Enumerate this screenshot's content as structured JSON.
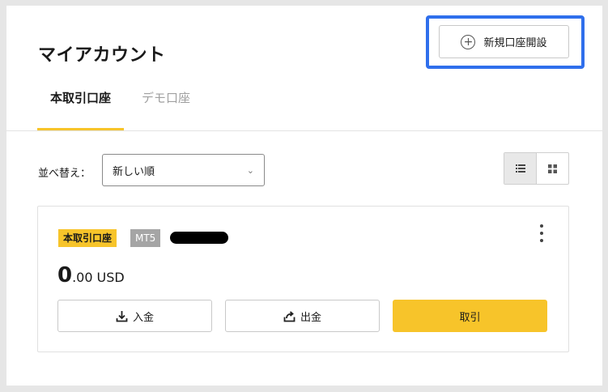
{
  "header": {
    "title": "マイアカウント",
    "new_account_label": "新規口座開設",
    "plus_icon": "plus-circle-icon"
  },
  "tabs": [
    {
      "label": "本取引口座",
      "active": true
    },
    {
      "label": "デモ口座",
      "active": false
    }
  ],
  "sort": {
    "label": "並べ替え：",
    "selected": "新しい順",
    "chevron_icon": "chevron-down-icon"
  },
  "view_toggle": {
    "list_icon": "list-icon",
    "grid_icon": "grid-icon",
    "active": "list"
  },
  "account_card": {
    "type_badge": "本取引口座",
    "platform_badge": "MT5",
    "balance_int": "0",
    "balance_dec": ".00",
    "currency": "USD",
    "buttons": {
      "deposit": "入金",
      "withdraw": "出金",
      "trade": "取引"
    }
  },
  "colors": {
    "accent_yellow": "#f7c42a",
    "highlight_blue": "#2f6fec",
    "mt5_badge": "#a5a5a5"
  }
}
